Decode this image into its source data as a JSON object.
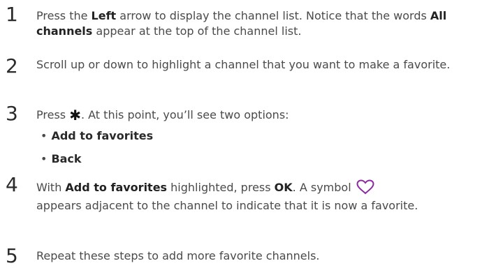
{
  "steps": [
    {
      "number": "1",
      "t1": "Press the ",
      "b1": "Left",
      "t2": " arrow to display the channel list. Notice that the words ",
      "b2": "All channels",
      "t3": " appear at the top of the channel list."
    },
    {
      "number": "2",
      "text": "Scroll up or down to highlight a channel that you want to make a favorite."
    },
    {
      "number": "3",
      "t1": "Press ",
      "t2": ". At this point, you’ll see two options:",
      "bullets": [
        "Add to favorites",
        "Back"
      ]
    },
    {
      "number": "4",
      "t1": "With ",
      "b1": "Add to favorites",
      "t2": " highlighted, press ",
      "b2": "OK",
      "t3": ". A symbol ",
      "t4": "appears adjacent to the channel to indicate that it is now a favorite."
    },
    {
      "number": "5",
      "text": "Repeat these steps to add more favorite channels."
    }
  ],
  "icons": {
    "star": "asterisk-icon",
    "heart": "heart-icon"
  },
  "colors": {
    "text": "#4a4a4a",
    "bold": "#222222",
    "heart": "#8a2aa0"
  }
}
